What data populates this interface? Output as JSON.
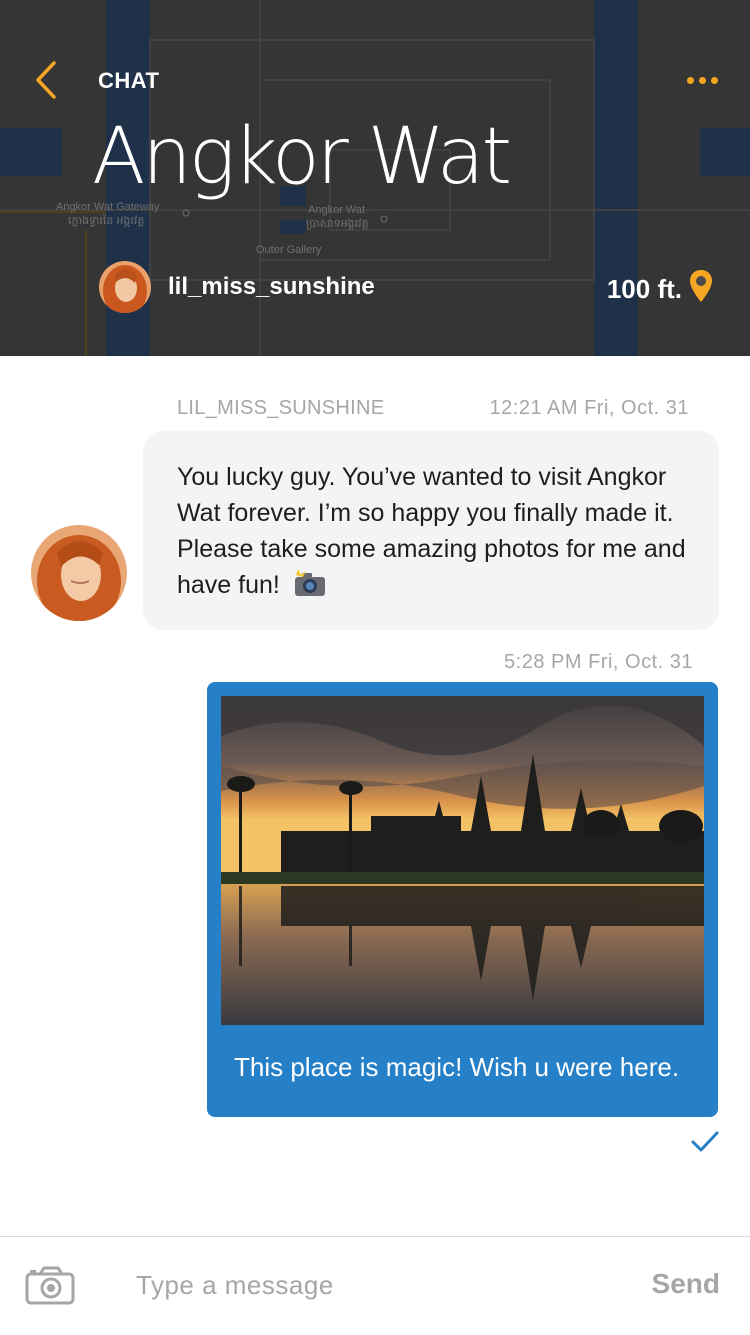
{
  "header": {
    "back_icon": "chevron-left-icon",
    "section_label": "CHAT",
    "title": "Angkor Wat",
    "more_icon": "ellipsis-icon",
    "username": "lil_miss_sunshine",
    "distance": "100 ft.",
    "pin_icon": "map-pin-icon",
    "accent_color": "#f5a623"
  },
  "map": {
    "labels": [
      "Angkor Wat Gateway",
      "ក្លោងទ្វារនៃ អង្គរវត្ត",
      "Angkor Wat",
      "ប្រាសាទអង្គរវត្ត",
      "Outer Gallery"
    ]
  },
  "messages": {
    "incoming": {
      "sender": "LIL_MISS_SUNSHINE",
      "timestamp": "12:21 AM Fri, Oct. 31",
      "text": "You lucky guy. You’ve wanted to visit Angkor Wat forever. I’m so happy you finally made it. Please take some amazing photos for me and have fun!",
      "emoji_icon": "camera-flash-emoji-icon"
    },
    "outgoing": {
      "timestamp": "5:28 PM Fri, Oct. 31",
      "caption": "This place is magic! Wish u were here.",
      "status_icon": "checkmark-icon",
      "bubble_color": "#2680c8"
    }
  },
  "composer": {
    "camera_icon": "camera-icon",
    "placeholder": "Type a message",
    "send_label": "Send"
  }
}
